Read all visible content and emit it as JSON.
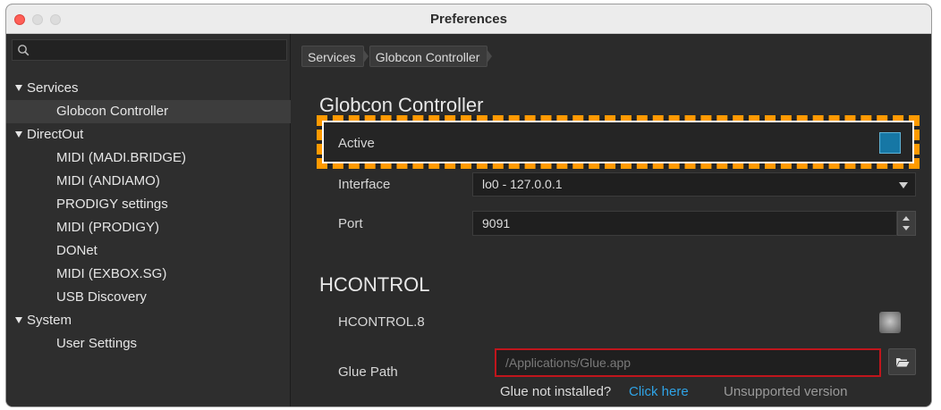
{
  "window": {
    "title": "Preferences"
  },
  "sidebar": {
    "search_placeholder": "",
    "groups": [
      {
        "label": "Services",
        "items": [
          "Globcon Controller"
        ]
      },
      {
        "label": "DirectOut",
        "items": [
          "MIDI (MADI.BRIDGE)",
          "MIDI (ANDIAMO)",
          "PRODIGY settings",
          "MIDI (PRODIGY)",
          "DONet",
          "MIDI (EXBOX.SG)",
          "USB Discovery"
        ]
      },
      {
        "label": "System",
        "items": [
          "User Settings"
        ]
      }
    ],
    "selected_item": "Globcon Controller"
  },
  "breadcrumb": [
    "Services",
    "Globcon Controller"
  ],
  "globcon": {
    "heading": "Globcon Controller",
    "active_label": "Active",
    "active_checked": true,
    "interface_label": "Interface",
    "interface_value": "lo0 - 127.0.0.1",
    "port_label": "Port",
    "port_value": "9091"
  },
  "hcontrol": {
    "heading": "HCONTROL",
    "device_label": "HCONTROL.8",
    "glue_path_label": "Glue Path",
    "glue_path_placeholder": "/Applications/Glue.app",
    "not_installed_text": "Glue not installed?",
    "click_here": "Click here",
    "unsupported": "Unsupported version"
  },
  "colors": {
    "accent_link": "#2fa3e6",
    "highlight_dashes": "#ff9a00",
    "checkbox_fill": "#1677a5",
    "error_border": "#c0151c"
  }
}
